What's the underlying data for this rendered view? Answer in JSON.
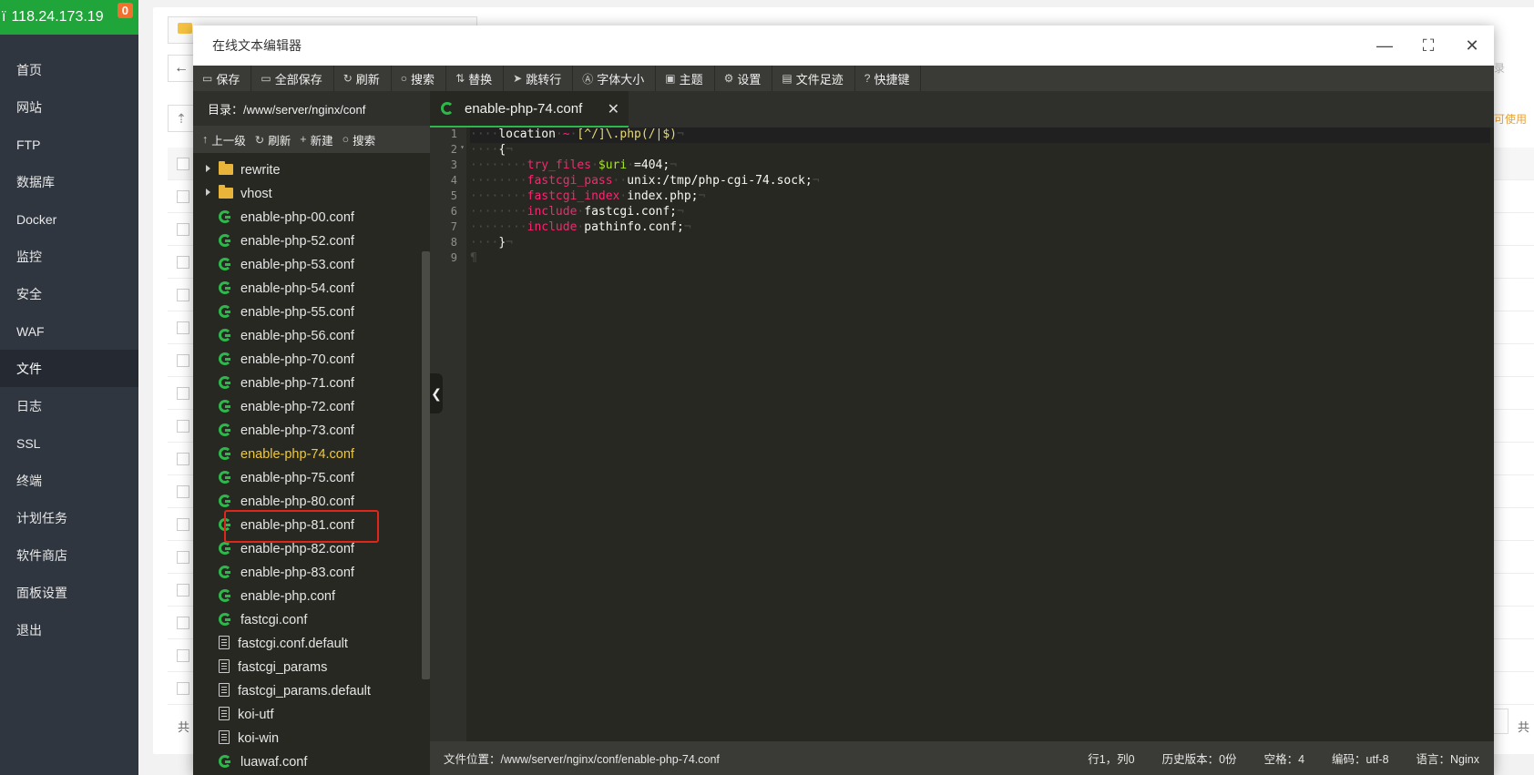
{
  "sidebar": {
    "server_ip": "118.24.173.19",
    "alert_count": "0",
    "items": [
      {
        "label": "首页",
        "icon": "home-icon"
      },
      {
        "label": "网站",
        "icon": "globe-icon"
      },
      {
        "label": "FTP",
        "icon": "ftp-icon"
      },
      {
        "label": "数据库",
        "icon": "database-icon"
      },
      {
        "label": "Docker",
        "icon": "docker-icon"
      },
      {
        "label": "监控",
        "icon": "monitor-icon"
      },
      {
        "label": "安全",
        "icon": "shield-icon"
      },
      {
        "label": "WAF",
        "icon": "waf-icon"
      },
      {
        "label": "文件",
        "icon": "folder-icon",
        "active": true
      },
      {
        "label": "日志",
        "icon": "log-icon"
      },
      {
        "label": "SSL",
        "icon": "ssl-icon"
      },
      {
        "label": "终端",
        "icon": "terminal-icon"
      },
      {
        "label": "计划任务",
        "icon": "calendar-icon"
      },
      {
        "label": "软件商店",
        "icon": "store-icon"
      },
      {
        "label": "面板设置",
        "icon": "settings-icon"
      },
      {
        "label": "退出",
        "icon": "logout-icon"
      }
    ]
  },
  "background": {
    "total_label": "共",
    "right_total_label": "共",
    "right_hint": "录",
    "right_warning": "可使用"
  },
  "editor": {
    "title": "在线文本编辑器",
    "window_controls": {
      "minimize": "—",
      "maximize": "⛶",
      "close": "✕"
    },
    "toolbar": [
      {
        "label": "保存",
        "icon": "save-icon",
        "glyph": "▭"
      },
      {
        "label": "全部保存",
        "icon": "save-all-icon",
        "glyph": "▭"
      },
      {
        "label": "刷新",
        "icon": "refresh-icon",
        "glyph": "↻"
      },
      {
        "label": "搜索",
        "icon": "search-icon",
        "glyph": "○"
      },
      {
        "label": "替换",
        "icon": "replace-icon",
        "glyph": "⇅"
      },
      {
        "label": "跳转行",
        "icon": "goto-line-icon",
        "glyph": "➤"
      },
      {
        "label": "字体大小",
        "icon": "font-size-icon",
        "glyph": "Ⓐ"
      },
      {
        "label": "主题",
        "icon": "theme-icon",
        "glyph": "▣"
      },
      {
        "label": "设置",
        "icon": "settings-icon",
        "glyph": "⚙"
      },
      {
        "label": "文件足迹",
        "icon": "history-icon",
        "glyph": "▤"
      },
      {
        "label": "快捷键",
        "icon": "shortcut-icon",
        "glyph": "?"
      }
    ],
    "tree": {
      "path_label": "目录：/www/server/nginx/conf",
      "actions": [
        {
          "label": "上一级",
          "glyph": "↑",
          "icon": "up-level-icon"
        },
        {
          "label": "刷新",
          "glyph": "↻",
          "icon": "refresh-icon"
        },
        {
          "label": "新建",
          "glyph": "+",
          "icon": "new-icon"
        },
        {
          "label": "搜索",
          "glyph": "○",
          "icon": "search-icon"
        }
      ],
      "items": [
        {
          "name": "rewrite",
          "type": "folder"
        },
        {
          "name": "vhost",
          "type": "folder"
        },
        {
          "name": "enable-php-00.conf",
          "type": "conf"
        },
        {
          "name": "enable-php-52.conf",
          "type": "conf"
        },
        {
          "name": "enable-php-53.conf",
          "type": "conf"
        },
        {
          "name": "enable-php-54.conf",
          "type": "conf"
        },
        {
          "name": "enable-php-55.conf",
          "type": "conf"
        },
        {
          "name": "enable-php-56.conf",
          "type": "conf"
        },
        {
          "name": "enable-php-70.conf",
          "type": "conf"
        },
        {
          "name": "enable-php-71.conf",
          "type": "conf"
        },
        {
          "name": "enable-php-72.conf",
          "type": "conf"
        },
        {
          "name": "enable-php-73.conf",
          "type": "conf"
        },
        {
          "name": "enable-php-74.conf",
          "type": "conf",
          "selected": true
        },
        {
          "name": "enable-php-75.conf",
          "type": "conf"
        },
        {
          "name": "enable-php-80.conf",
          "type": "conf"
        },
        {
          "name": "enable-php-81.conf",
          "type": "conf"
        },
        {
          "name": "enable-php-82.conf",
          "type": "conf"
        },
        {
          "name": "enable-php-83.conf",
          "type": "conf"
        },
        {
          "name": "enable-php.conf",
          "type": "conf"
        },
        {
          "name": "fastcgi.conf",
          "type": "conf"
        },
        {
          "name": "fastcgi.conf.default",
          "type": "doc"
        },
        {
          "name": "fastcgi_params",
          "type": "doc"
        },
        {
          "name": "fastcgi_params.default",
          "type": "doc"
        },
        {
          "name": "koi-utf",
          "type": "doc"
        },
        {
          "name": "koi-win",
          "type": "doc"
        },
        {
          "name": "luawaf.conf",
          "type": "conf"
        }
      ]
    },
    "tab": {
      "label": "enable-php-74.conf",
      "close": "✕"
    },
    "code_lines": [
      [
        {
          "t": "····",
          "c": "ws"
        },
        {
          "t": "location",
          "c": "op"
        },
        {
          "t": "·",
          "c": "ws"
        },
        {
          "t": "~",
          "c": "kw"
        },
        {
          "t": "·",
          "c": "ws"
        },
        {
          "t": "[^/]\\.php(/|$)",
          "c": "re"
        },
        {
          "t": "¬",
          "c": "ws"
        }
      ],
      [
        {
          "t": "····",
          "c": "ws"
        },
        {
          "t": "{",
          "c": "op"
        },
        {
          "t": "¬",
          "c": "ws"
        }
      ],
      [
        {
          "t": "········",
          "c": "ws"
        },
        {
          "t": "try_files",
          "c": "kw"
        },
        {
          "t": "·",
          "c": "ws"
        },
        {
          "t": "$uri",
          "c": "var"
        },
        {
          "t": "·",
          "c": "ws"
        },
        {
          "t": "=404;",
          "c": "op"
        },
        {
          "t": "¬",
          "c": "ws"
        }
      ],
      [
        {
          "t": "········",
          "c": "ws"
        },
        {
          "t": "fastcgi_pass",
          "c": "kw"
        },
        {
          "t": "··",
          "c": "ws"
        },
        {
          "t": "unix:/tmp/php-cgi-74.sock;",
          "c": "op"
        },
        {
          "t": "¬",
          "c": "ws"
        }
      ],
      [
        {
          "t": "········",
          "c": "ws"
        },
        {
          "t": "fastcgi_index",
          "c": "kw"
        },
        {
          "t": "·",
          "c": "ws"
        },
        {
          "t": "index.php;",
          "c": "op"
        },
        {
          "t": "¬",
          "c": "ws"
        }
      ],
      [
        {
          "t": "········",
          "c": "ws"
        },
        {
          "t": "include",
          "c": "kw"
        },
        {
          "t": "·",
          "c": "ws"
        },
        {
          "t": "fastcgi.conf;",
          "c": "op"
        },
        {
          "t": "¬",
          "c": "ws"
        }
      ],
      [
        {
          "t": "········",
          "c": "ws"
        },
        {
          "t": "include",
          "c": "kw"
        },
        {
          "t": "·",
          "c": "ws"
        },
        {
          "t": "pathinfo.conf;",
          "c": "op"
        },
        {
          "t": "¬",
          "c": "ws"
        }
      ],
      [
        {
          "t": "····",
          "c": "ws"
        },
        {
          "t": "}",
          "c": "op"
        },
        {
          "t": "¬",
          "c": "ws"
        }
      ],
      [
        {
          "t": "¶",
          "c": "ws"
        }
      ]
    ],
    "line_numbers": [
      "1",
      "2",
      "3",
      "4",
      "5",
      "6",
      "7",
      "8",
      "9"
    ],
    "collapse_glyph": "❮",
    "status": {
      "file_path": "文件位置：/www/server/nginx/conf/enable-php-74.conf",
      "cursor": "行1，列0",
      "history": "历史版本：0份",
      "indent": "空格：4",
      "encoding": "编码：utf-8",
      "language": "语言：Nginx"
    }
  }
}
